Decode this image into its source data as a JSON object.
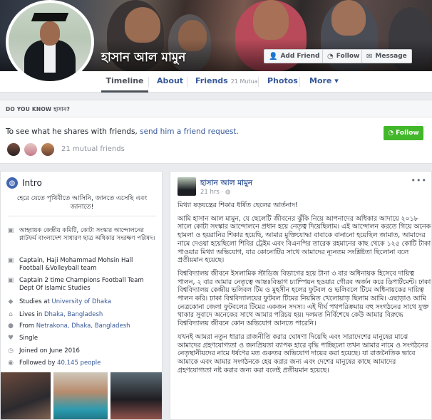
{
  "profile": {
    "name": "হাসান আল মামুন",
    "buttons": {
      "add_friend": "Add Friend",
      "follow": "Follow",
      "message": "Message"
    }
  },
  "tabs": [
    {
      "label": "Timeline"
    },
    {
      "label": "About"
    },
    {
      "label": "Friends",
      "sub": "21 Mutual"
    },
    {
      "label": "Photos"
    },
    {
      "label": "More",
      "chevron": "▾"
    }
  ],
  "know": {
    "header": "DO YOU KNOW হাসান?",
    "message_prefix": "To see what he shares with friends,",
    "message_link": "send him a friend request.",
    "follow_button": "Follow",
    "mutual_friends": "21 mutual friends"
  },
  "intro": {
    "title": "Intro",
    "bio": "হেরে যেতে পৃথিবীতে আসিনি, জানতে এসেছি এবং জানাতে!",
    "items": [
      {
        "icon": "briefcase-icon",
        "text": "আহ্বায়ক কেন্দ্রীয় কমিটি, কোটা সংস্কার আন্দোলনের প্লাটফর্ম বাংলাদেশ সাধারণ ছাত্র অধিকার সংরক্ষণ পরিষদ।"
      },
      {
        "icon": "briefcase-icon",
        "text": "Captain, Haji Mohammad Mohsin Hall Football &Volleyball team"
      },
      {
        "icon": "briefcase-icon",
        "text": "Captain 2 time Champions Football Team Dept Of Islamic Studies"
      },
      {
        "icon": "graduation-cap-icon",
        "prefix": "Studies at",
        "link": "University of Dhaka"
      },
      {
        "icon": "home-icon",
        "prefix": "Lives in",
        "link": "Dhaka, Bangladesh"
      },
      {
        "icon": "location-pin-icon",
        "prefix": "From",
        "link": "Netrakona, Dhaka, Bangladesh"
      },
      {
        "icon": "heart-icon",
        "text": "Single"
      },
      {
        "icon": "clock-icon",
        "text": "Joined on June 2016"
      },
      {
        "icon": "followers-icon",
        "prefix": "Followed by",
        "link": "40,145 people"
      }
    ]
  },
  "post": {
    "author": "হাসান আল মামুন",
    "time": "21 hrs",
    "privacy_icon": "globe-icon",
    "more": "•••",
    "paragraphs": [
      "মিথ্যা ষড়যন্ত্রের শিকার ধর্ষিত ছেলের আর্তনাদ!",
      "আমি হাসান আল মামুন, যে ছেলেটি জীবনের ঝুঁকি নিয়ে আপনাদের অধিকার আদায়ে ২০১৮ সালে কোটা সংস্কার আন্দোলনে প্রধান হয়ে নেতৃত্ব দিয়েছিলাম। এই আন্দোলন করতে গিয়ে অনেক হামলা ও হয়রানির শিকার হয়েছি, আমার মুক্তিযোদ্ধা বাবাকে বানানো হয়েছিল জামাত, আমাদের নামে দেওয়া হয়েছিলো শিবির ট্রেইম এবং বিএনপির তারেক রহমানের কাছ থেকে ১২৫ কোটি টাকা পাওয়ার মিথ্যা অভিযোগ, যার কোনোটির সাথে আমাদের ন্যূনতম সংশ্লিষ্টতা ছিলোনা বলে প্রতীয়মান হয়েছে।",
      "বিশ্ববিদ্যালয় জীবনে ইসলামিক স্টাডিজ বিভাগের হয়ে টানা ৩ বার অধিনায়ক হিসেবে দায়িত্ব পালন, ২ বার আমার নেতৃত্বে আন্তঃবিভাগ চ্যাম্পিয়ন হওয়ার গৌরব অর্জন করে ডিপার্টমেন্ট। ঢাকা বিশ্ববিদ্যালয় কেন্দ্রীয় ভলিবল টিম ও মুহসীন হলের ফুটবল ও ভলিবলে টিমে অধিনায়কের দায়িত্ব পালন করি। ঢাকা বিশ্ববিদ্যালয়ের ফুটবল টিমের নিয়মিত খেলোয়াড় ছিলাম আমি। এছাড়াও আমি নেত্রকোনা জেলা ফুটবলের টিমের একজন সদস্য। এই দীর্ঘ পথপরিক্রমায় বহু সংগঠনের সাথে যুক্ত থাকার সুবাদে অনেকের সাথে আমার পরিচয় হয়। দলমত নির্বিশেষে কেউ আমার বিরুদ্ধে বিশ্ববিদ্যালয় জীবনে কোন অভিযোগ আনতে পারেনি।",
      "যখনই আমরা নতুন ধারার রাজনীতি করার ঘোষণা দিয়েছি এবং সারাদেশের মানুষের মাঝে আমাদের গ্রহণযোগ্যতা ও জনপ্রিয়তা ব্যাপক হারে বৃদ্ধি পাচ্ছিলো তখন আমার নামে ও সংগঠনের নেতৃস্থানীয়দের নামে ধর্ষণের মত গুরুতর অভিযোগ দায়ের করা হয়েছে। যা রাজনৈতিক ভাবে আমাকে এবং আমার সংগঠনকে হেয় করার জন্য এবং দেশের মানুষের কাছে আমাদের গ্রহণযোগ্যতা নষ্ট করার জন্য করা বলেই প্রতীয়মান হয়েছে।"
    ]
  }
}
